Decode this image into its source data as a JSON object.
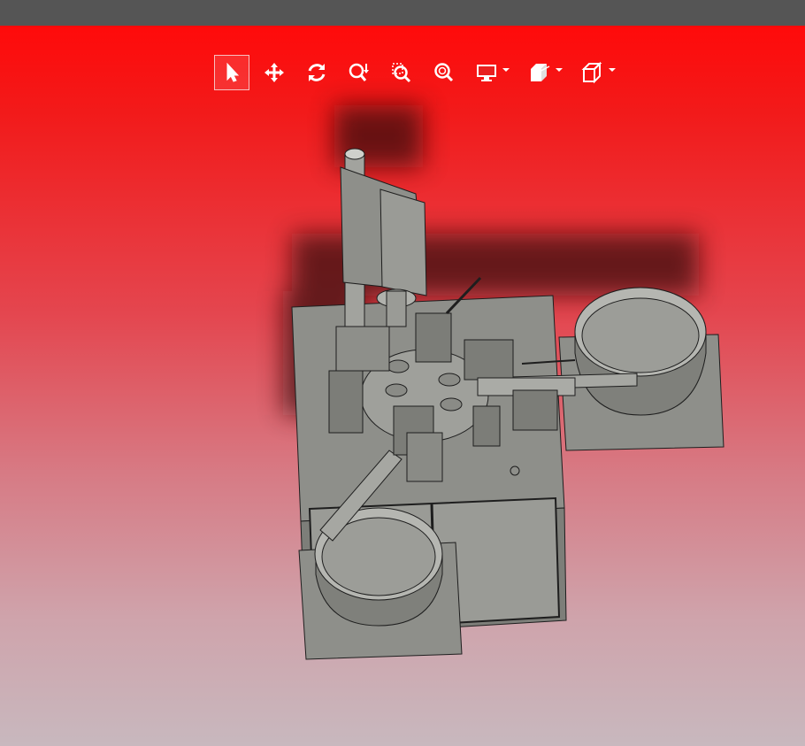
{
  "window": {
    "title_bar_color": "#555555"
  },
  "viewport": {
    "background_top_color": "#ff0a0a",
    "background_bottom_color": "#c8b8be"
  },
  "toolbar": {
    "tools": [
      {
        "id": "select",
        "icon": "cursor-arrow-icon",
        "active": true,
        "has_dropdown": false
      },
      {
        "id": "pan",
        "icon": "move-arrows-icon",
        "active": false,
        "has_dropdown": false
      },
      {
        "id": "rotate",
        "icon": "rotate-icon",
        "active": false,
        "has_dropdown": false
      },
      {
        "id": "zoom",
        "icon": "zoom-icon",
        "active": false,
        "has_dropdown": false
      },
      {
        "id": "zoom-window",
        "icon": "zoom-window-icon",
        "active": false,
        "has_dropdown": false
      },
      {
        "id": "zoom-fit",
        "icon": "zoom-fit-icon",
        "active": false,
        "has_dropdown": false
      },
      {
        "id": "display",
        "icon": "monitor-icon",
        "active": false,
        "has_dropdown": true
      },
      {
        "id": "section",
        "icon": "section-box-icon",
        "active": false,
        "has_dropdown": true
      },
      {
        "id": "view-orientation",
        "icon": "view-cube-icon",
        "active": false,
        "has_dropdown": true
      }
    ]
  },
  "model": {
    "description_icon": "cad-assembly-model",
    "body_color": "#8e8f8a",
    "edge_color": "#1e1e1e"
  }
}
